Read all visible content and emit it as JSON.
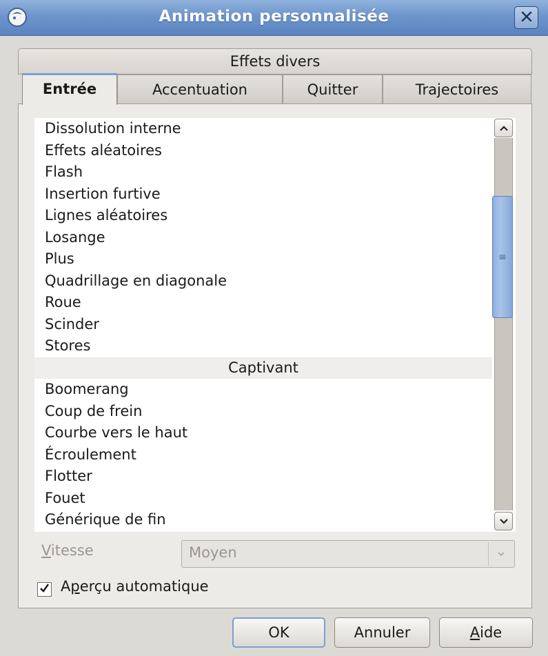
{
  "window": {
    "title": "Animation personnalisée",
    "app_icon": "openoffice-icon",
    "close_icon": "close-icon"
  },
  "tabs": {
    "top_row": [
      "Effets divers"
    ],
    "bottom_row": [
      {
        "label": "Entrée",
        "active": true
      },
      {
        "label": "Accentuation",
        "active": false
      },
      {
        "label": "Quitter",
        "active": false
      },
      {
        "label": "Trajectoires",
        "active": false
      }
    ]
  },
  "effects_list": {
    "items_before_header": [
      "Dissolution interne",
      "Effets aléatoires",
      "Flash",
      "Insertion furtive",
      "Lignes aléatoires",
      "Losange",
      "Plus",
      "Quadrillage en diagonale",
      "Roue",
      "Scinder",
      "Stores"
    ],
    "category_header": "Captivant",
    "items_after_header": [
      "Boomerang",
      "Coup de frein",
      "Courbe vers le haut",
      "Écroulement",
      "Flotter",
      "Fouet",
      "Générique de fin"
    ]
  },
  "speed": {
    "label_mnemonic": "V",
    "label_rest": "itesse",
    "value": "Moyen",
    "enabled": false
  },
  "preview": {
    "label_before": "A",
    "label_mnemonic": "p",
    "label_after": "erçu automatique",
    "checked": true
  },
  "buttons": {
    "ok": "OK",
    "cancel": "Annuler",
    "help_mnemonic": "A",
    "help_rest": "ide"
  }
}
